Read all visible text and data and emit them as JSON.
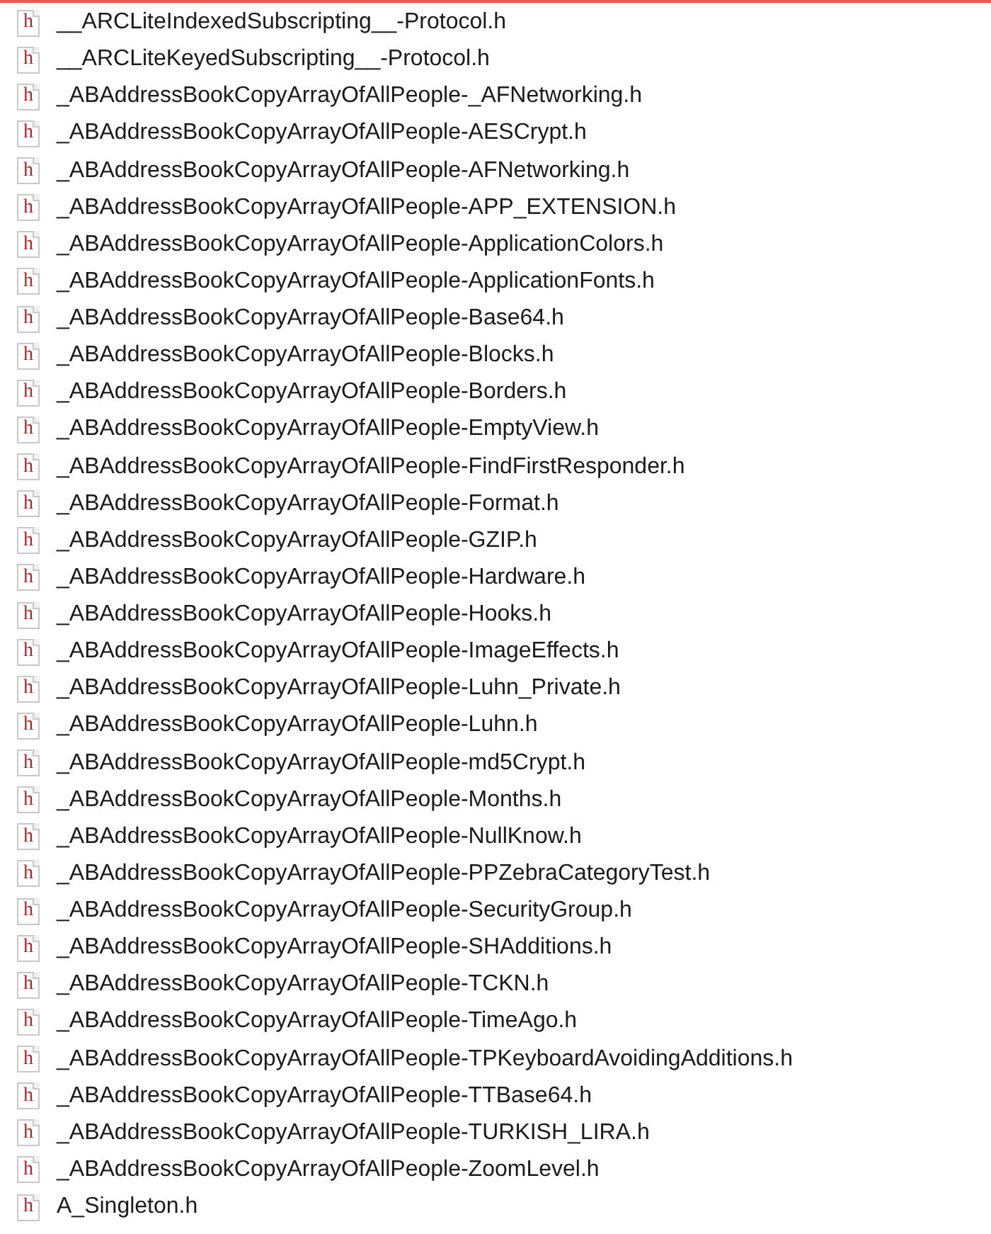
{
  "files": [
    {
      "name": "__ARCLiteIndexedSubscripting__-Protocol.h",
      "icon": "h"
    },
    {
      "name": "__ARCLiteKeyedSubscripting__-Protocol.h",
      "icon": "h"
    },
    {
      "name": "_ABAddressBookCopyArrayOfAllPeople-_AFNetworking.h",
      "icon": "h"
    },
    {
      "name": "_ABAddressBookCopyArrayOfAllPeople-AESCrypt.h",
      "icon": "h"
    },
    {
      "name": "_ABAddressBookCopyArrayOfAllPeople-AFNetworking.h",
      "icon": "h"
    },
    {
      "name": "_ABAddressBookCopyArrayOfAllPeople-APP_EXTENSION.h",
      "icon": "h"
    },
    {
      "name": "_ABAddressBookCopyArrayOfAllPeople-ApplicationColors.h",
      "icon": "h"
    },
    {
      "name": "_ABAddressBookCopyArrayOfAllPeople-ApplicationFonts.h",
      "icon": "h"
    },
    {
      "name": "_ABAddressBookCopyArrayOfAllPeople-Base64.h",
      "icon": "h"
    },
    {
      "name": "_ABAddressBookCopyArrayOfAllPeople-Blocks.h",
      "icon": "h"
    },
    {
      "name": "_ABAddressBookCopyArrayOfAllPeople-Borders.h",
      "icon": "h"
    },
    {
      "name": "_ABAddressBookCopyArrayOfAllPeople-EmptyView.h",
      "icon": "h"
    },
    {
      "name": "_ABAddressBookCopyArrayOfAllPeople-FindFirstResponder.h",
      "icon": "h"
    },
    {
      "name": "_ABAddressBookCopyArrayOfAllPeople-Format.h",
      "icon": "h"
    },
    {
      "name": "_ABAddressBookCopyArrayOfAllPeople-GZIP.h",
      "icon": "h"
    },
    {
      "name": "_ABAddressBookCopyArrayOfAllPeople-Hardware.h",
      "icon": "h"
    },
    {
      "name": "_ABAddressBookCopyArrayOfAllPeople-Hooks.h",
      "icon": "h"
    },
    {
      "name": "_ABAddressBookCopyArrayOfAllPeople-ImageEffects.h",
      "icon": "h"
    },
    {
      "name": "_ABAddressBookCopyArrayOfAllPeople-Luhn_Private.h",
      "icon": "h"
    },
    {
      "name": "_ABAddressBookCopyArrayOfAllPeople-Luhn.h",
      "icon": "h"
    },
    {
      "name": "_ABAddressBookCopyArrayOfAllPeople-md5Crypt.h",
      "icon": "h"
    },
    {
      "name": "_ABAddressBookCopyArrayOfAllPeople-Months.h",
      "icon": "h"
    },
    {
      "name": "_ABAddressBookCopyArrayOfAllPeople-NullKnow.h",
      "icon": "h"
    },
    {
      "name": "_ABAddressBookCopyArrayOfAllPeople-PPZebraCategoryTest.h",
      "icon": "h"
    },
    {
      "name": "_ABAddressBookCopyArrayOfAllPeople-SecurityGroup.h",
      "icon": "h"
    },
    {
      "name": "_ABAddressBookCopyArrayOfAllPeople-SHAdditions.h",
      "icon": "h"
    },
    {
      "name": "_ABAddressBookCopyArrayOfAllPeople-TCKN.h",
      "icon": "h"
    },
    {
      "name": "_ABAddressBookCopyArrayOfAllPeople-TimeAgo.h",
      "icon": "h"
    },
    {
      "name": "_ABAddressBookCopyArrayOfAllPeople-TPKeyboardAvoidingAdditions.h",
      "icon": "h"
    },
    {
      "name": "_ABAddressBookCopyArrayOfAllPeople-TTBase64.h",
      "icon": "h"
    },
    {
      "name": "_ABAddressBookCopyArrayOfAllPeople-TURKISH_LIRA.h",
      "icon": "h"
    },
    {
      "name": "_ABAddressBookCopyArrayOfAllPeople-ZoomLevel.h",
      "icon": "h"
    },
    {
      "name": "A_Singleton.h",
      "icon": "h"
    }
  ]
}
